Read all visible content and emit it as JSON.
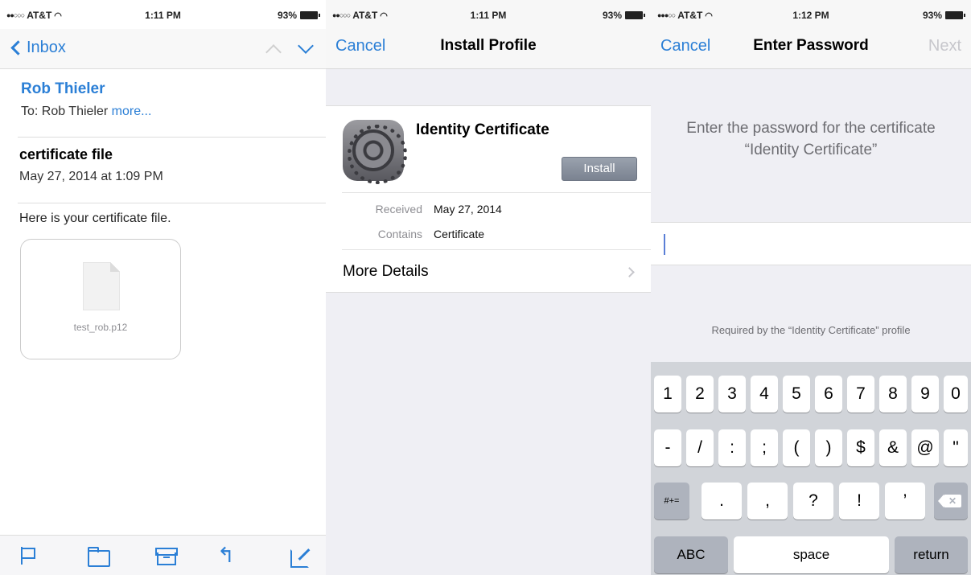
{
  "status": {
    "panel1": {
      "carrier": "AT&T",
      "time": "1:11 PM",
      "battery": "93%"
    },
    "panel2": {
      "carrier": "AT&T",
      "time": "1:11 PM",
      "battery": "93%"
    },
    "panel3": {
      "carrier": "AT&T",
      "time": "1:12 PM",
      "battery": "93%"
    }
  },
  "mail": {
    "back_label": "Inbox",
    "from": "Rob Thieler",
    "to_prefix": "To: Rob Thieler",
    "more_link": "more...",
    "subject": "certificate file",
    "date": "May 27, 2014 at 1:09 PM",
    "body": "Here is your certificate file.",
    "attachment_name": "test_rob.p12"
  },
  "install": {
    "cancel": "Cancel",
    "title": "Install Profile",
    "cert_title": "Identity Certificate",
    "install_button": "Install",
    "received_label": "Received",
    "received_value": "May 27, 2014",
    "contains_label": "Contains",
    "contains_value": "Certificate",
    "more_details": "More Details"
  },
  "password": {
    "cancel": "Cancel",
    "title": "Enter Password",
    "next": "Next",
    "instruction_line1": "Enter the password for the certificate",
    "instruction_line2": "“Identity Certificate”",
    "required_text": "Required by the “Identity Certificate” profile"
  },
  "keyboard": {
    "row1": [
      "1",
      "2",
      "3",
      "4",
      "5",
      "6",
      "7",
      "8",
      "9",
      "0"
    ],
    "row2": [
      "-",
      "/",
      ":",
      ";",
      "(",
      ")",
      "$",
      "&",
      "@",
      "\""
    ],
    "row3": [
      ".",
      ",",
      "?",
      "!",
      "’"
    ],
    "symbols_key": "#+=",
    "abc_key": "ABC",
    "space_key": "space",
    "return_key": "return"
  }
}
